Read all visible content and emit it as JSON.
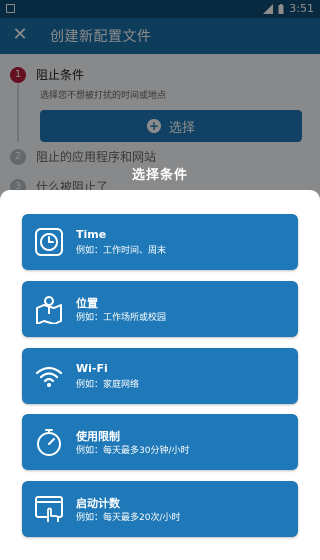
{
  "status": {
    "time": "3:51"
  },
  "appbar": {
    "title": "创建新配置文件",
    "close_icon": "close-icon"
  },
  "steps": [
    {
      "number": "1",
      "label": "阻止条件",
      "hint": "选择您不想被打扰的时间或地点"
    },
    {
      "number": "2",
      "label": "阻止的应用程序和网站"
    },
    {
      "number": "3",
      "label": "什么被阻止了"
    }
  ],
  "select_button": {
    "label": "选择"
  },
  "sheet": {
    "title": "选择条件",
    "options": [
      {
        "icon": "clock-icon",
        "title": "Time",
        "subtitle": "例如：工作时间、周末"
      },
      {
        "icon": "map-location-icon",
        "title": "位置",
        "subtitle": "例如：工作场所或校园"
      },
      {
        "icon": "wifi-icon",
        "title": "Wi-Fi",
        "subtitle": "例如：家庭网络"
      },
      {
        "icon": "timer-icon",
        "title": "使用限制",
        "subtitle": "例如：每天最多30分钟/小时"
      },
      {
        "icon": "tap-screen-icon",
        "title": "启动计数",
        "subtitle": "例如：每天最多20次/小时"
      }
    ]
  },
  "colors": {
    "primary": "#1f79b8",
    "appbar": "#1a6ea7",
    "statusbar": "#0e4d77",
    "step_active": "#b61e3b"
  }
}
